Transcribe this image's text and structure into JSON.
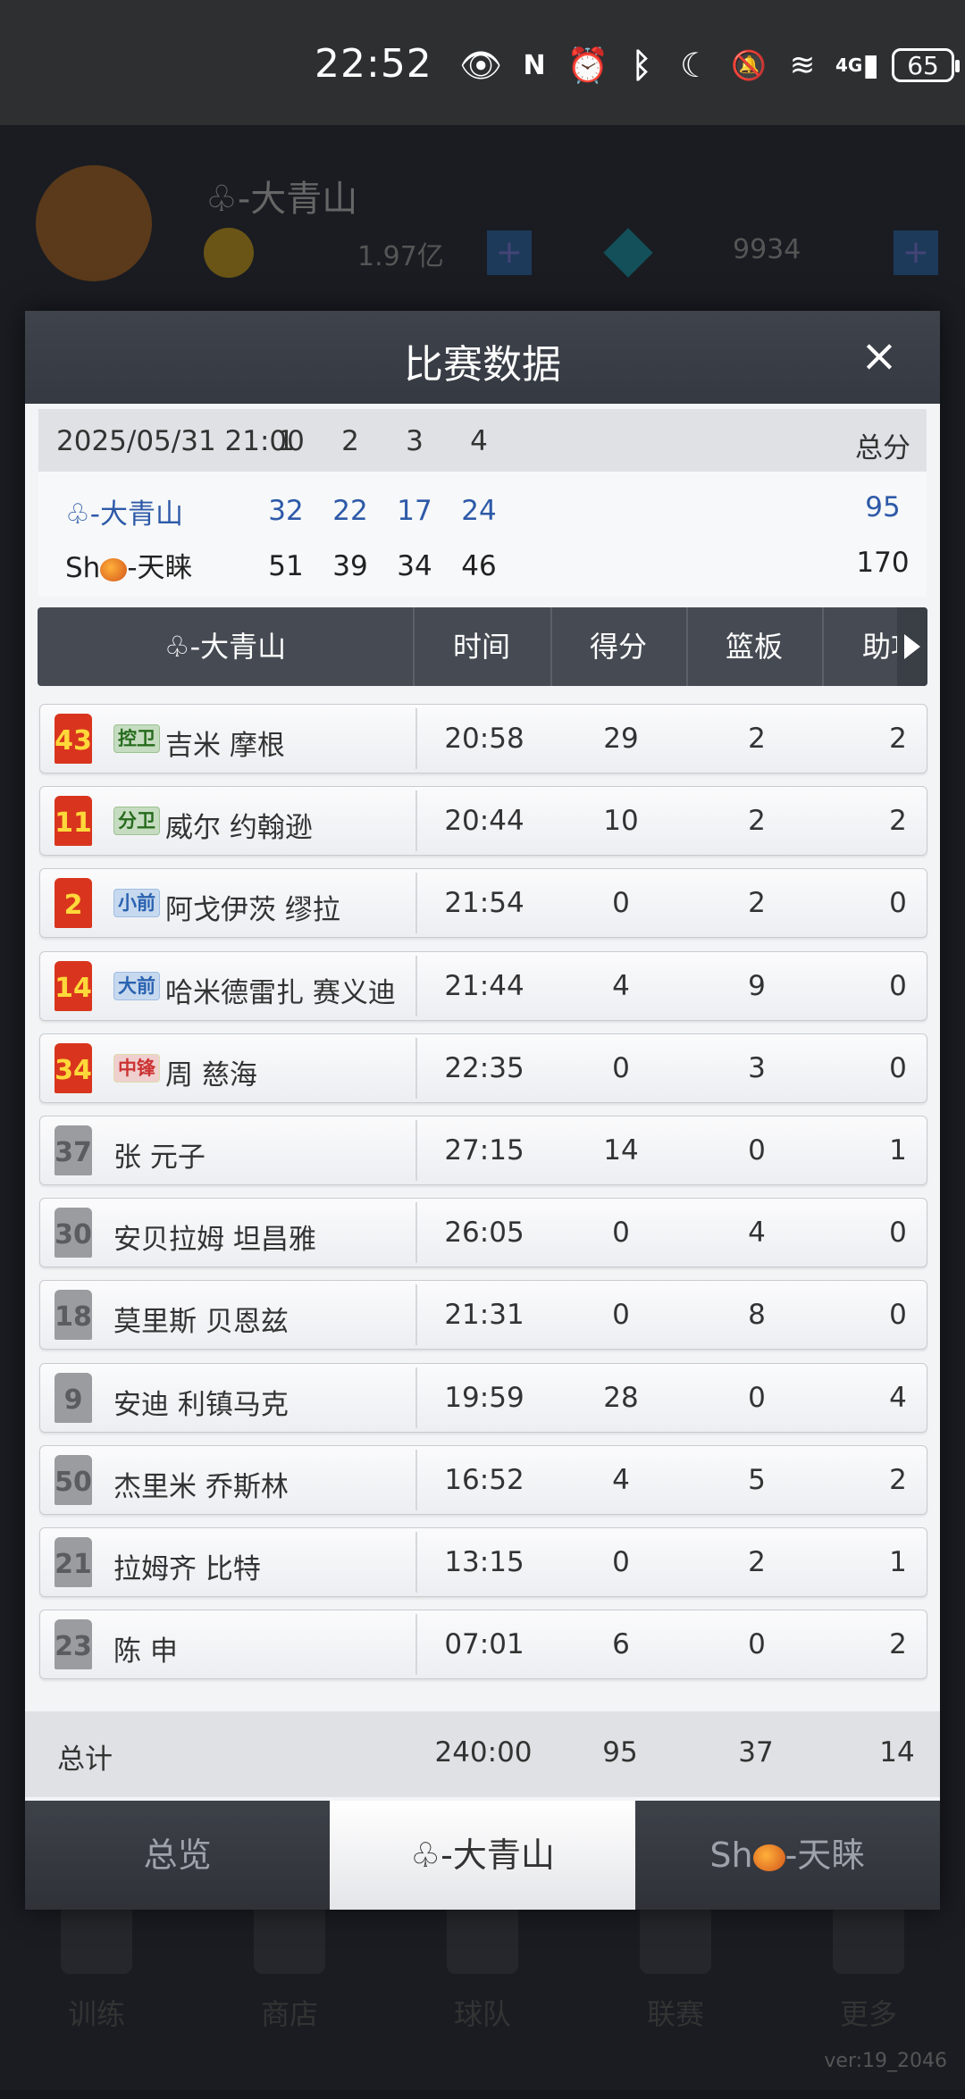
{
  "status_bar": {
    "time": "22:52",
    "icons": [
      "eye-icon",
      "nfc-icon",
      "alarm-icon",
      "bluetooth-icon",
      "moon-icon",
      "bell-off-icon",
      "wifi-icon",
      "signal-icon"
    ],
    "network": "4G",
    "battery": "65"
  },
  "background": {
    "team_name": "♧-大青山",
    "coins": "1.97亿",
    "gems": "9934",
    "nav_items": [
      "训练",
      "商店",
      "球队",
      "联赛",
      "更多"
    ],
    "version": "ver:19_2046"
  },
  "modal": {
    "title": "比赛数据",
    "close": "×",
    "scoreboard": {
      "datetime": "2025/05/31 21:00",
      "quarters": [
        "1",
        "2",
        "3",
        "4"
      ],
      "total_label": "总分",
      "teams": [
        {
          "name": "♧-大青山",
          "q": [
            "32",
            "22",
            "17",
            "24"
          ],
          "total": "95"
        },
        {
          "name_prefix": "Sh",
          "name_suffix": "-天睐",
          "q": [
            "51",
            "39",
            "34",
            "46"
          ],
          "total": "170"
        }
      ]
    },
    "table": {
      "team_col": "♧-大青山",
      "columns": [
        "时间",
        "得分",
        "篮板",
        "助攻"
      ],
      "rows": [
        {
          "num": "43",
          "pos": "控卫",
          "name": "吉米 摩根",
          "time": "20:58",
          "pts": "29",
          "reb": "2",
          "ast": "2",
          "starter": true
        },
        {
          "num": "11",
          "pos": "分卫",
          "name": "威尔  约翰逊",
          "time": "20:44",
          "pts": "10",
          "reb": "2",
          "ast": "2",
          "starter": true
        },
        {
          "num": "2",
          "pos": "小前",
          "name": "阿戈伊茨 缪拉",
          "time": "21:54",
          "pts": "0",
          "reb": "2",
          "ast": "0",
          "starter": true
        },
        {
          "num": "14",
          "pos": "大前",
          "name": "哈米德雷扎 赛义迪",
          "time": "21:44",
          "pts": "4",
          "reb": "9",
          "ast": "0",
          "starter": true
        },
        {
          "num": "34",
          "pos": "中锋",
          "name": "周 慈海",
          "time": "22:35",
          "pts": "0",
          "reb": "3",
          "ast": "0",
          "starter": true
        },
        {
          "num": "37",
          "pos": "",
          "name": "张 元子",
          "time": "27:15",
          "pts": "14",
          "reb": "0",
          "ast": "1",
          "starter": false
        },
        {
          "num": "30",
          "pos": "",
          "name": "安贝拉姆 坦昌雅",
          "time": "26:05",
          "pts": "0",
          "reb": "4",
          "ast": "0",
          "starter": false
        },
        {
          "num": "18",
          "pos": "",
          "name": "莫里斯 贝恩兹",
          "time": "21:31",
          "pts": "0",
          "reb": "8",
          "ast": "0",
          "starter": false
        },
        {
          "num": "9",
          "pos": "",
          "name": "安迪 利镇马克",
          "time": "19:59",
          "pts": "28",
          "reb": "0",
          "ast": "4",
          "starter": false
        },
        {
          "num": "50",
          "pos": "",
          "name": "杰里米 乔斯林",
          "time": "16:52",
          "pts": "4",
          "reb": "5",
          "ast": "2",
          "starter": false
        },
        {
          "num": "21",
          "pos": "",
          "name": "拉姆齐 比特",
          "time": "13:15",
          "pts": "0",
          "reb": "2",
          "ast": "1",
          "starter": false
        },
        {
          "num": "23",
          "pos": "",
          "name": "陈 申",
          "time": "07:01",
          "pts": "6",
          "reb": "0",
          "ast": "2",
          "starter": false
        }
      ],
      "totals": {
        "label": "总计",
        "time": "240:00",
        "pts": "95",
        "reb": "37",
        "ast": "14"
      }
    },
    "tabs": [
      {
        "label": "总览",
        "active": false
      },
      {
        "label": "♧-大青山",
        "active": true
      },
      {
        "label_prefix": "Sh",
        "label_suffix": "-天睐",
        "active": false
      }
    ]
  }
}
